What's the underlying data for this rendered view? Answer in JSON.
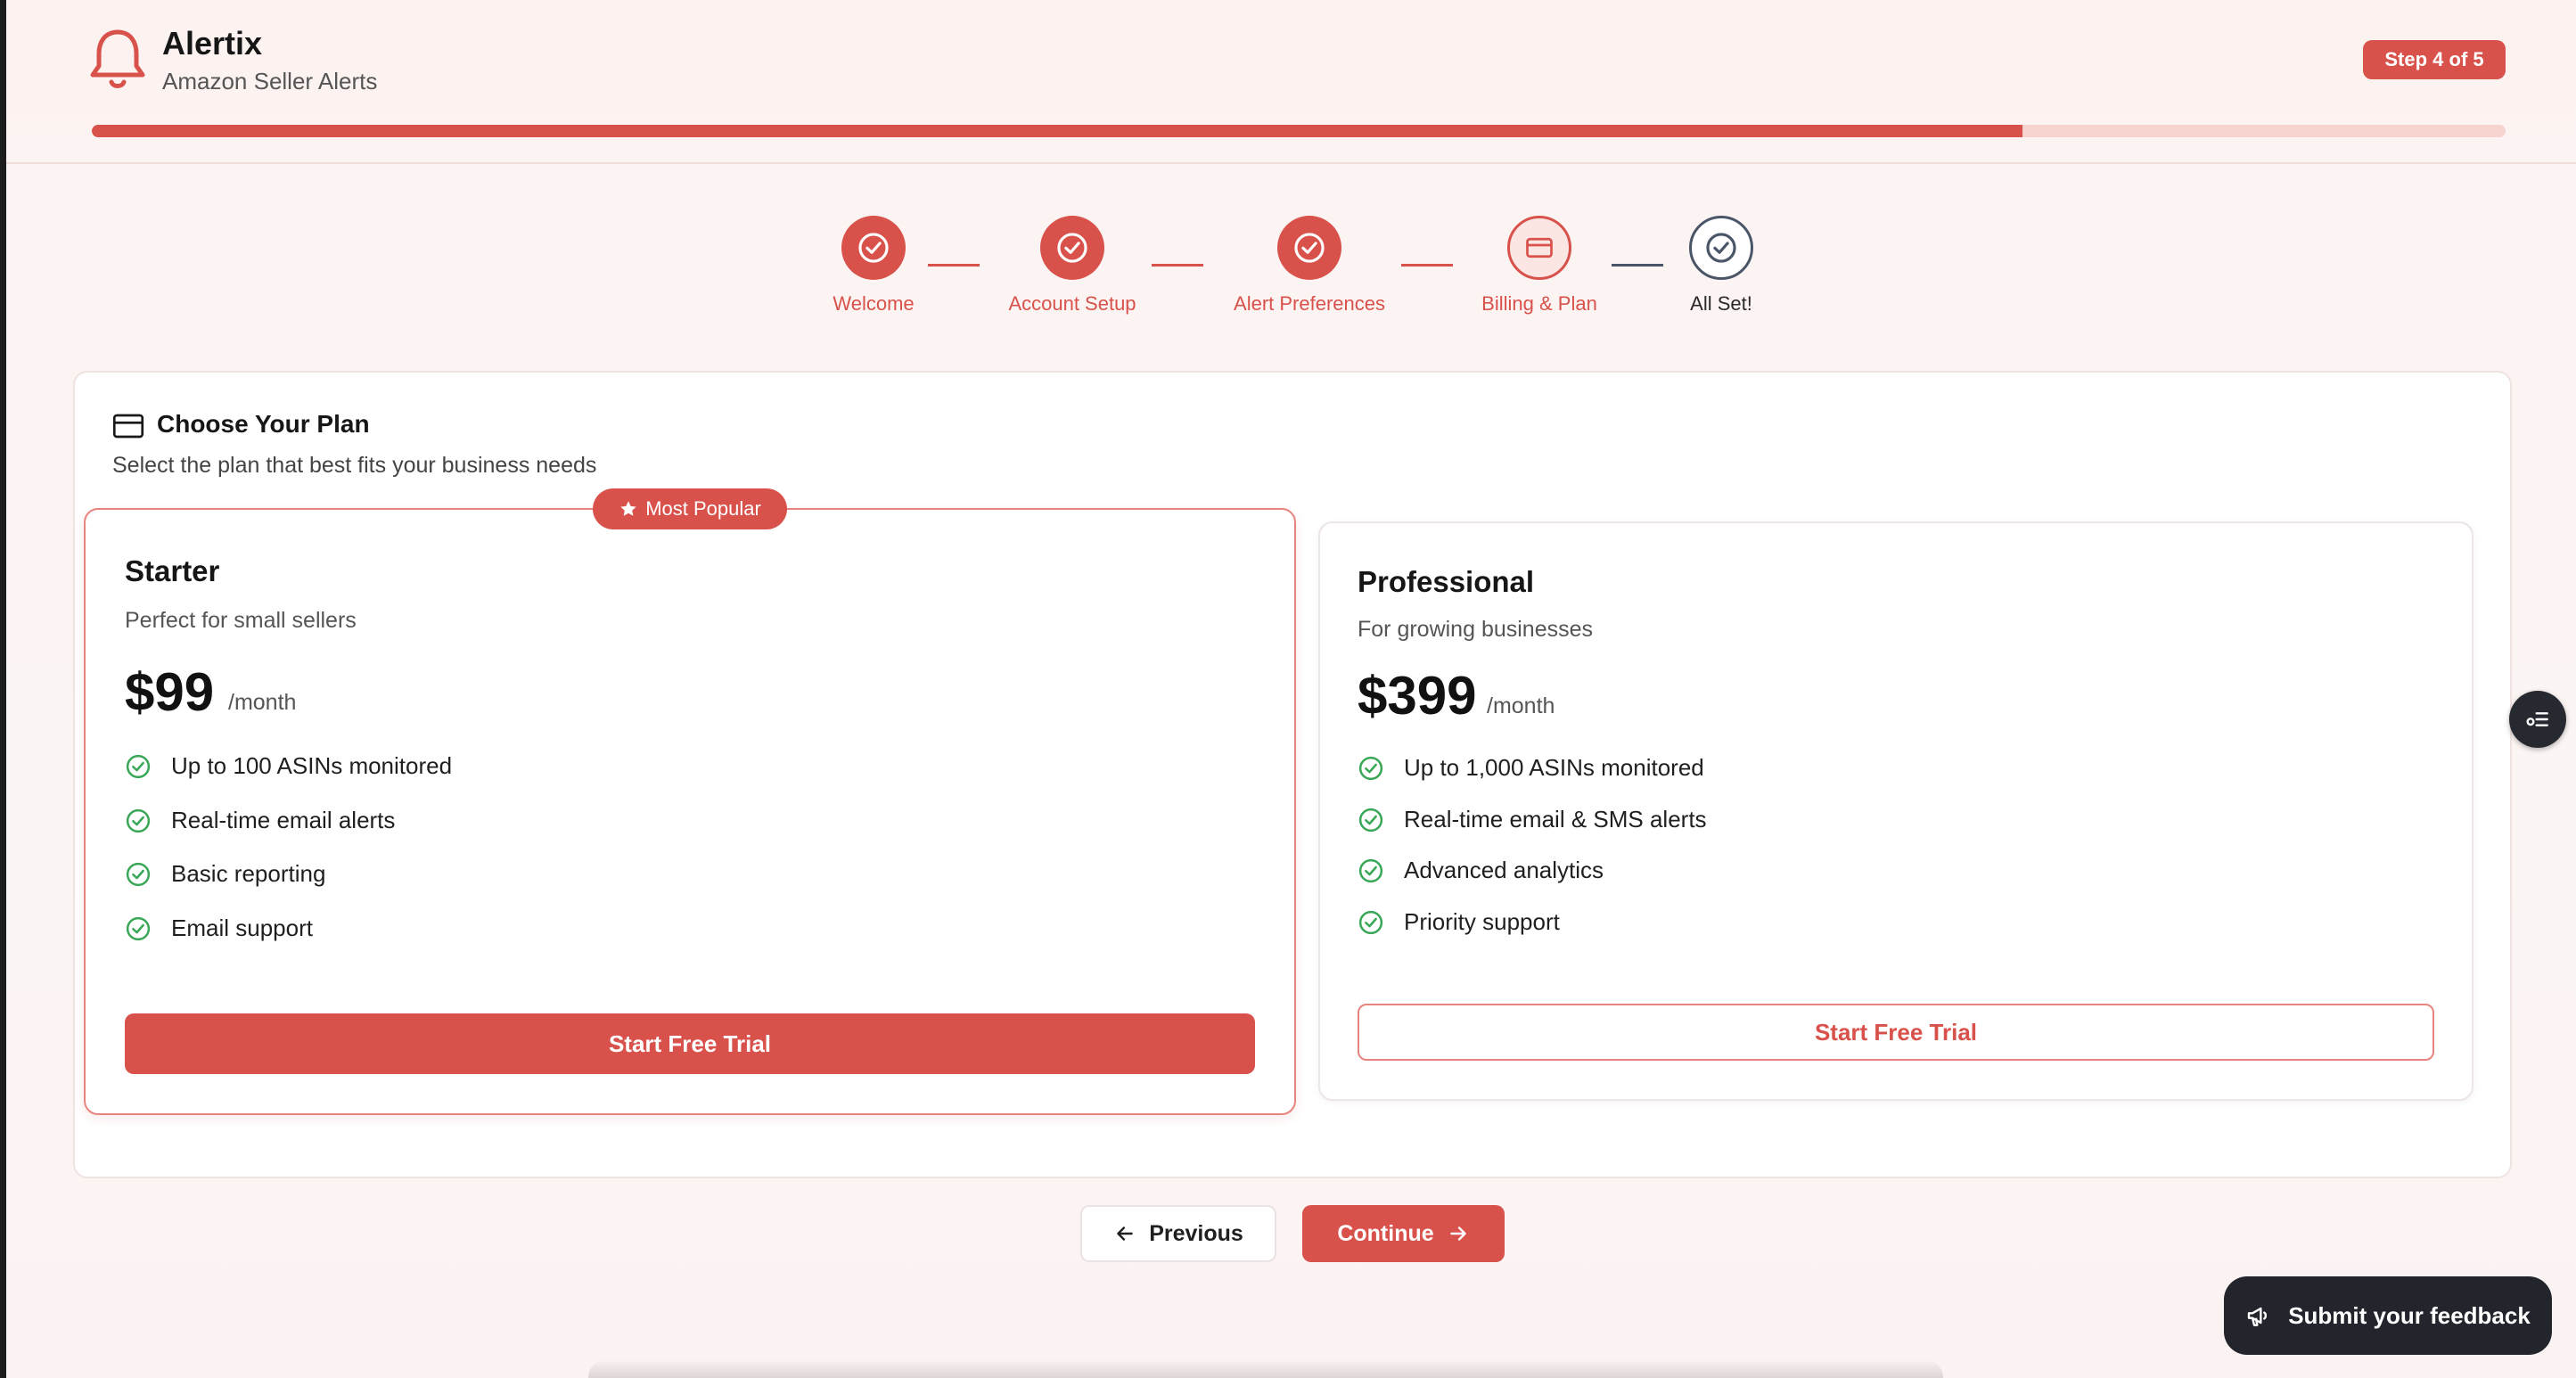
{
  "app": {
    "title": "Alertix",
    "subtitle": "Amazon Seller Alerts"
  },
  "header": {
    "step_badge": "Step 4 of 5",
    "progress": 0.8
  },
  "stepper": {
    "steps": [
      {
        "label": "Welcome",
        "state": "done",
        "icon": "check-circle-icon"
      },
      {
        "label": "Account Setup",
        "state": "done",
        "icon": "check-circle-icon"
      },
      {
        "label": "Alert Preferences",
        "state": "done",
        "icon": "check-circle-icon"
      },
      {
        "label": "Billing & Plan",
        "state": "current",
        "icon": "credit-card-icon"
      },
      {
        "label": "All Set!",
        "state": "upcoming",
        "icon": "check-circle-icon"
      }
    ]
  },
  "plans_card": {
    "title": "Choose Your Plan",
    "description": "Select the plan that best fits your business needs",
    "icon": "credit-card-icon"
  },
  "plans": [
    {
      "name": "Starter",
      "description": "Perfect for small sellers",
      "price": "$99",
      "unit": "/month",
      "badge": "Most Popular",
      "features": [
        "Up to 100 ASINs monitored",
        "Real-time email alerts",
        "Basic reporting",
        "Email support"
      ],
      "cta": "Start Free Trial"
    },
    {
      "name": "Professional",
      "description": "For growing businesses",
      "price": "$399",
      "unit": "/month",
      "features": [
        "Up to 1,000 ASINs monitored",
        "Real-time email & SMS alerts",
        "Advanced analytics",
        "Priority support"
      ],
      "cta": "Start Free Trial"
    }
  ],
  "nav": {
    "previous": "Previous",
    "continue": "Continue"
  },
  "feedback": {
    "label": "Submit your feedback"
  },
  "colors": {
    "accent": "#d9514b",
    "success": "#3aa757",
    "dark": "#23252c"
  }
}
